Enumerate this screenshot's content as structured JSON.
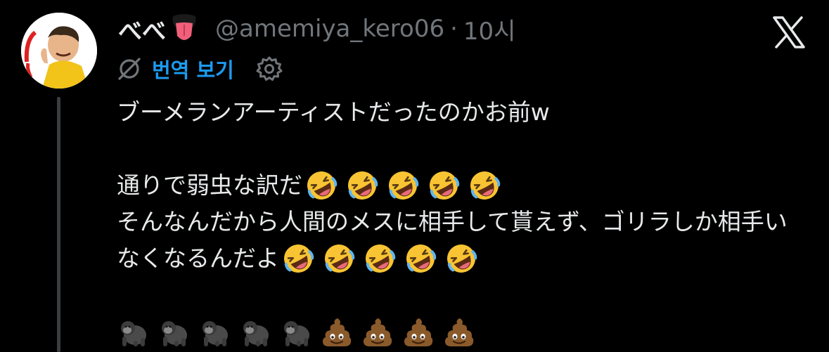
{
  "tweet": {
    "display_name": "べべ",
    "handle": "@amemiya_kero06",
    "separator": "·",
    "timestamp": "10시",
    "translate_label": "번역 보기",
    "name_emoji": "tongue-emoji",
    "lines": [
      {
        "text": "ブーメランアーティストだったのかお前w",
        "emojis": []
      },
      {
        "text": "",
        "emojis": []
      },
      {
        "text": "通りで弱虫な訳だ",
        "emojis": [
          "rofl",
          "rofl",
          "rofl",
          "rofl",
          "rofl"
        ]
      },
      {
        "text": "そんなんだから人間のメスに相手して貰えず、ゴリラしか相手い",
        "emojis": []
      },
      {
        "text": "なくなるんだよ",
        "emojis": [
          "rofl",
          "rofl",
          "rofl",
          "rofl",
          "rofl"
        ]
      },
      {
        "text": "",
        "emojis": []
      },
      {
        "text": "",
        "emojis": [
          "gorilla",
          "gorilla",
          "gorilla",
          "gorilla",
          "gorilla",
          "poop",
          "poop",
          "poop",
          "poop"
        ]
      }
    ]
  },
  "icons": {
    "translate": "translate-disabled-icon",
    "settings": "gear-icon",
    "brand": "x-logo-icon"
  },
  "colors": {
    "background": "#000000",
    "text": "#e7e9ea",
    "muted": "#71767b",
    "accent": "#1d9bf0"
  }
}
